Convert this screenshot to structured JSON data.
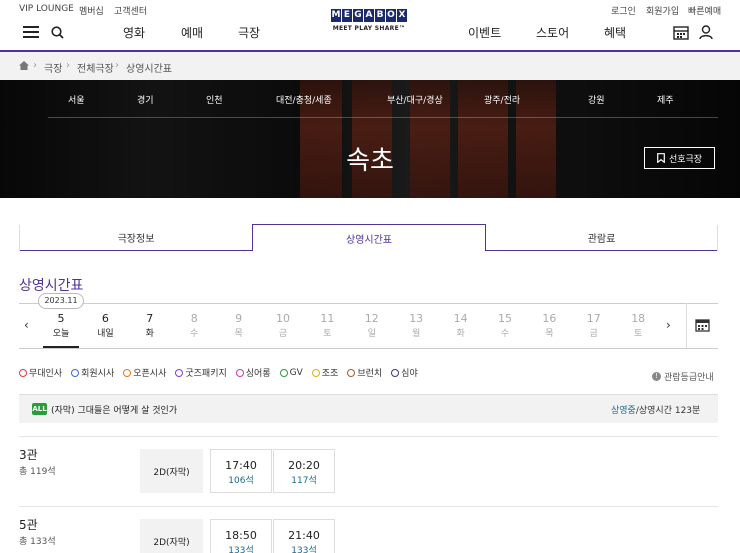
{
  "utility": {
    "vip": "VIP LOUNGE",
    "membership": "멤버십",
    "support": "고객센터",
    "login": "로그인",
    "signup": "회원가입",
    "quick_booking": "빠른예매"
  },
  "nav": {
    "movie": "영화",
    "booking": "예매",
    "theater": "극장",
    "event": "이벤트",
    "store": "스토어",
    "benefit": "혜택"
  },
  "logo": {
    "letters": [
      "M",
      "E",
      "G",
      "A",
      "B",
      "O",
      "X"
    ],
    "tagline": "MEET PLAY SHARE™"
  },
  "breadcrumb": [
    "극장",
    "전체극장",
    "상영시간표"
  ],
  "regions": [
    "서울",
    "경기",
    "인천",
    "대전/충청/세종",
    "부산/대구/경상",
    "광주/전라",
    "강원",
    "제주"
  ],
  "theater_name": "속초",
  "favorite_label": "선호극장",
  "tabs": [
    "극장정보",
    "상영시간표",
    "관람료"
  ],
  "schedule_title": "상영시간표",
  "month_badge": "2023.11",
  "dates": [
    {
      "num": "5",
      "dow": "오늘",
      "state": "today"
    },
    {
      "num": "6",
      "dow": "내일",
      "state": "normal"
    },
    {
      "num": "7",
      "dow": "화",
      "state": "normal"
    },
    {
      "num": "8",
      "dow": "수",
      "state": "dim"
    },
    {
      "num": "9",
      "dow": "목",
      "state": "dim"
    },
    {
      "num": "10",
      "dow": "금",
      "state": "dim"
    },
    {
      "num": "11",
      "dow": "토",
      "state": "dim"
    },
    {
      "num": "12",
      "dow": "일",
      "state": "dim"
    },
    {
      "num": "13",
      "dow": "월",
      "state": "dim"
    },
    {
      "num": "14",
      "dow": "화",
      "state": "dim"
    },
    {
      "num": "15",
      "dow": "수",
      "state": "dim"
    },
    {
      "num": "16",
      "dow": "목",
      "state": "dim"
    },
    {
      "num": "17",
      "dow": "금",
      "state": "dim"
    },
    {
      "num": "18",
      "dow": "토",
      "state": "dim"
    }
  ],
  "legend": [
    {
      "label": "무대인사",
      "color": "#e03a3a"
    },
    {
      "label": "회원시사",
      "color": "#3a6ad6"
    },
    {
      "label": "오픈시사",
      "color": "#e07a1a"
    },
    {
      "label": "굿즈패키지",
      "color": "#8a3ad6"
    },
    {
      "label": "싱어롱",
      "color": "#d63a9a"
    },
    {
      "label": "GV",
      "color": "#2a9d3a"
    },
    {
      "label": "조조",
      "color": "#e0b01a"
    },
    {
      "label": "브런치",
      "color": "#a0602a"
    },
    {
      "label": "심야",
      "color": "#3a3a8a"
    }
  ],
  "rating_guide": "관람등급안내",
  "movie": {
    "age": "ALL",
    "title": "(자막) 그대들은 어떻게 살 것인가",
    "status": "상영중",
    "runtime": "/상영시간 123분"
  },
  "halls": [
    {
      "name": "3관",
      "seats": "총 119석",
      "format": "2D(자막)",
      "times": [
        {
          "time": "17:40",
          "seats": "106석"
        },
        {
          "time": "20:20",
          "seats": "117석"
        }
      ]
    },
    {
      "name": "5관",
      "seats": "총 133석",
      "format": "2D(자막)",
      "times": [
        {
          "time": "18:50",
          "seats": "133석"
        },
        {
          "time": "21:40",
          "seats": "133석"
        }
      ]
    }
  ]
}
